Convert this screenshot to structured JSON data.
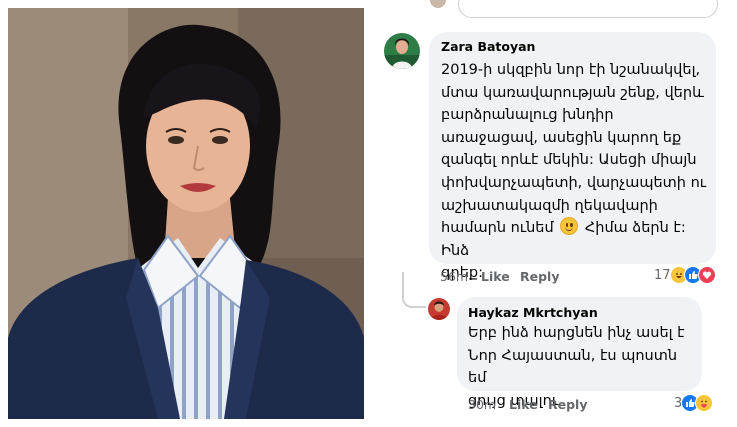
{
  "comments": [
    {
      "author": "Zara Batoyan",
      "text_before_emoji": "2019-ի սկզբին նոր էի նշանակվել,\nմտա կառավարության շենք, վերև\nբարձրանալուց խնդիր\nառաջացավ, ասեցին կարող եք\nզանգել որևէ մեկին: Ասեցի միայն\nփոխվարչապետի, վարչապետի ու\nաշխատակազմի ղեկավարի\nհամարն ունեմ",
      "text_after_emoji": "Հիմա ձերն է: Ինձ\nգրեք:",
      "time": "56m",
      "like_label": "Like",
      "reply_label": "Reply",
      "reaction_count": "17",
      "reactions": [
        "haha",
        "like",
        "love"
      ]
    }
  ],
  "reply": {
    "author": "Haykaz Mkrtchyan",
    "text": "Երբ ինձ հարցնեն ինչ ասել է\nՆոր Հայաստան, էս պոստն եմ\nցույց տալու",
    "time": "30m",
    "like_label": "Like",
    "reply_label": "Reply",
    "reaction_count": "3",
    "reactions": [
      "like",
      "care"
    ]
  },
  "colors": {
    "bubble_bg": "#f0f2f5",
    "meta_text": "#65676b",
    "like_blue": "#1877f2",
    "love_red": "#f33e58",
    "haha_yellow": "#f7c53a"
  }
}
